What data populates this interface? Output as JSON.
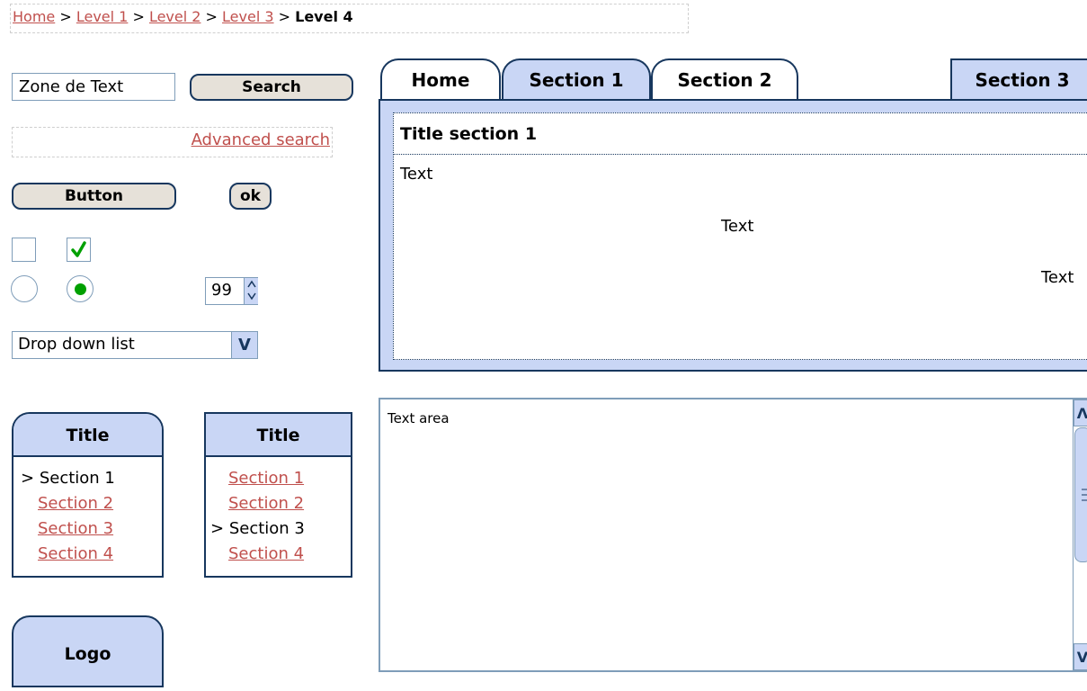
{
  "breadcrumb": {
    "items": [
      "Home",
      "Level 1",
      "Level 2",
      "Level 3"
    ],
    "separator": ">",
    "current": "Level 4"
  },
  "search": {
    "input_value": "Zone de Text",
    "button_label": "Search",
    "advanced_link": "Advanced search"
  },
  "buttons": {
    "button_label": "Button",
    "ok_label": "ok"
  },
  "controls": {
    "checkbox1_checked": false,
    "checkbox2_checked": true,
    "radio1_selected": false,
    "radio2_selected": true,
    "spinner_value": "99",
    "spinner_up_icon": "chevron-up-icon",
    "spinner_down_icon": "chevron-down-icon",
    "dropdown_value": "Drop down list",
    "dropdown_arrow": "V"
  },
  "tabs": {
    "labels": [
      "Home",
      "Section 1",
      "Section 2",
      "Section 3"
    ],
    "active_index": 1,
    "section_title": "Title section 1",
    "text_left": "Text",
    "text_center": "Text",
    "text_right": "Text"
  },
  "menu_left": {
    "title": "Title",
    "items": [
      "Section 1",
      "Section 2",
      "Section 3",
      "Section 4"
    ],
    "current_index": 0,
    "current_prefix": ">"
  },
  "menu_right": {
    "title": "Title",
    "items": [
      "Section 1",
      "Section 2",
      "Section 3",
      "Section 4"
    ],
    "current_index": 2,
    "current_prefix": ">"
  },
  "logo": {
    "label": "Logo"
  },
  "textarea": {
    "value": "Text area",
    "scroll_up": "Λ",
    "scroll_down": "V"
  },
  "colors": {
    "accent_blue": "#c9d6f5",
    "border_navy": "#17375e",
    "link_red": "#c0504d",
    "check_green": "#00a000",
    "button_beige": "#e6e1d9"
  }
}
